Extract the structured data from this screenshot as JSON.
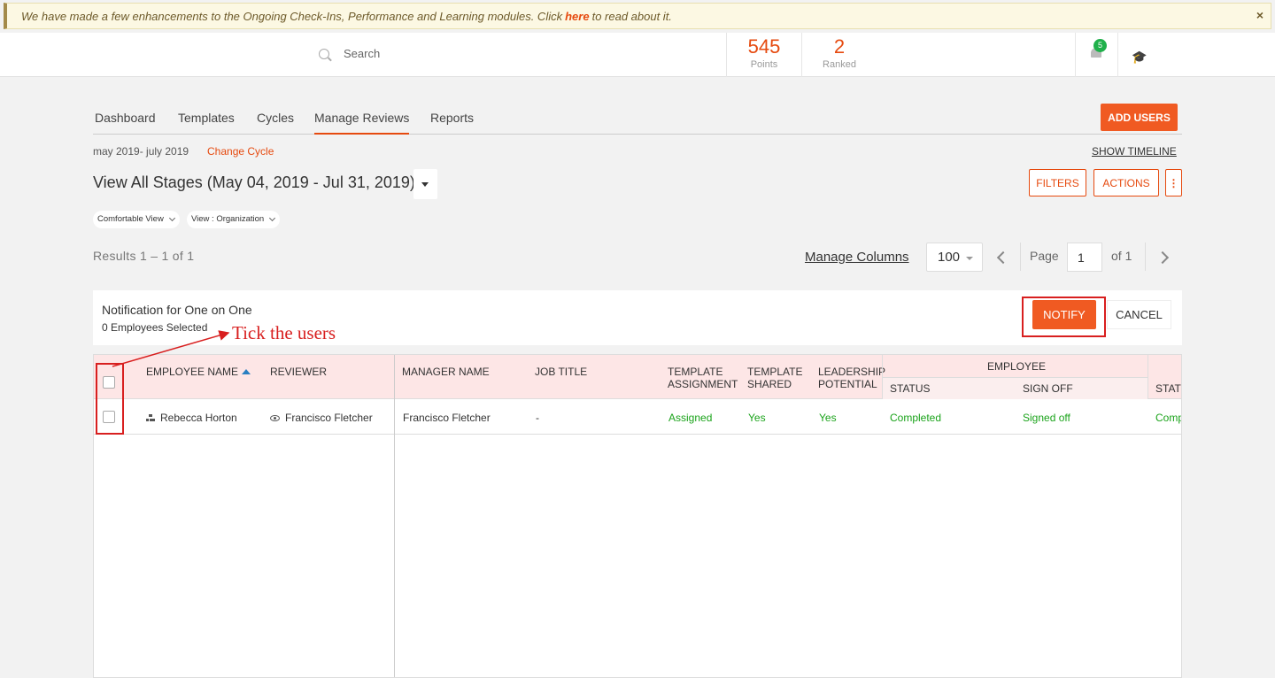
{
  "banner": {
    "text_before": "We have made a few enhancements to the Ongoing Check-Ins, Performance and Learning modules. Click",
    "link_text": "here",
    "text_after": "to read about it.",
    "close": "×"
  },
  "header": {
    "search_placeholder": "Search",
    "points_value": "545",
    "points_label": "Points",
    "ranked_value": "2",
    "ranked_label": "Ranked",
    "notification_count": "5",
    "cap_icon": "🎓"
  },
  "tabs": [
    {
      "label": "Dashboard"
    },
    {
      "label": "Templates"
    },
    {
      "label": "Cycles"
    },
    {
      "label": "Manage Reviews",
      "active": true
    },
    {
      "label": "Reports"
    }
  ],
  "add_users_label": "ADD USERS",
  "cycle": {
    "range": "may 2019- july 2019",
    "change_label": "Change Cycle",
    "show_timeline": "SHOW TIMELINE"
  },
  "view": {
    "title": "View All Stages (May 04, 2019 - Jul 31, 2019)",
    "filters_label": "FILTERS",
    "actions_label": "ACTIONS",
    "more_label": "⋮",
    "comfortable_view": "Comfortable View",
    "organization_view": "View : Organization"
  },
  "pagination": {
    "results": "Results 1 – 1 of 1",
    "manage_columns": "Manage Columns",
    "per_page": "100",
    "page_label": "Page",
    "page_value": "1",
    "of_label": "of 1"
  },
  "notification": {
    "title": "Notification for One on One",
    "selected": "0 Employees Selected",
    "notify_label": "NOTIFY",
    "cancel_label": "CANCEL"
  },
  "annotation": {
    "text": "Tick the users",
    "color": "#d81f1f"
  },
  "table": {
    "headers": {
      "employee_name": "EMPLOYEE NAME",
      "reviewer": "REVIEWER",
      "manager_name": "MANAGER NAME",
      "job_title": "JOB TITLE",
      "template_assignment_1": "TEMPLATE",
      "template_assignment_2": "ASSIGNMENT",
      "template_shared_1": "TEMPLATE",
      "template_shared_2": "SHARED",
      "leadership_1": "LEADERSHIP",
      "leadership_2": "POTENTIAL",
      "employee_group": "EMPLOYEE",
      "status": "STATUS",
      "sign_off": "SIGN OFF",
      "stat_cut": "STAT"
    },
    "rows": [
      {
        "employee_name": "Rebecca Horton",
        "reviewer": "Francisco Fletcher",
        "manager_name": "Francisco Fletcher",
        "job_title": "-",
        "template_assignment": "Assigned",
        "template_shared": "Yes",
        "leadership_potential": "Yes",
        "status": "Completed",
        "sign_off": "Signed off",
        "next_cut": "Comp"
      }
    ]
  },
  "colors": {
    "accent": "#f05a22",
    "status_green": "#1aa31a",
    "header_pink": "#fde6e6"
  }
}
